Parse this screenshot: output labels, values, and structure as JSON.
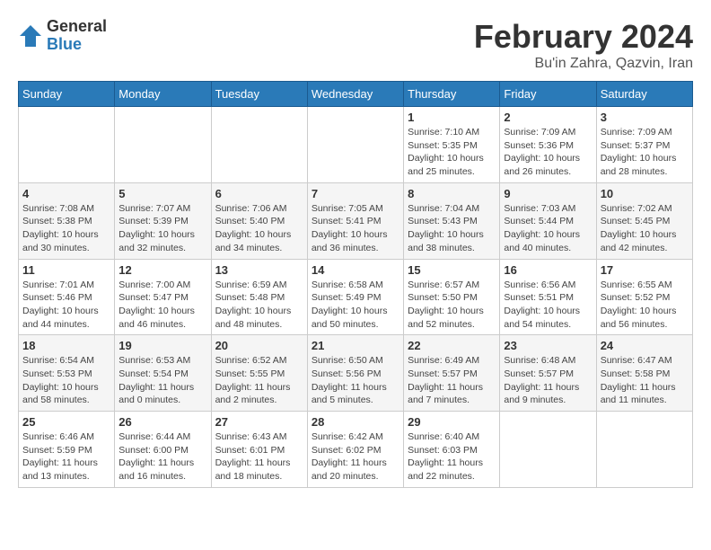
{
  "logo": {
    "general": "General",
    "blue": "Blue"
  },
  "title": "February 2024",
  "subtitle": "Bu'in Zahra, Qazvin, Iran",
  "days_header": [
    "Sunday",
    "Monday",
    "Tuesday",
    "Wednesday",
    "Thursday",
    "Friday",
    "Saturday"
  ],
  "weeks": [
    [
      {
        "day": "",
        "info": ""
      },
      {
        "day": "",
        "info": ""
      },
      {
        "day": "",
        "info": ""
      },
      {
        "day": "",
        "info": ""
      },
      {
        "day": "1",
        "info": "Sunrise: 7:10 AM\nSunset: 5:35 PM\nDaylight: 10 hours\nand 25 minutes."
      },
      {
        "day": "2",
        "info": "Sunrise: 7:09 AM\nSunset: 5:36 PM\nDaylight: 10 hours\nand 26 minutes."
      },
      {
        "day": "3",
        "info": "Sunrise: 7:09 AM\nSunset: 5:37 PM\nDaylight: 10 hours\nand 28 minutes."
      }
    ],
    [
      {
        "day": "4",
        "info": "Sunrise: 7:08 AM\nSunset: 5:38 PM\nDaylight: 10 hours\nand 30 minutes."
      },
      {
        "day": "5",
        "info": "Sunrise: 7:07 AM\nSunset: 5:39 PM\nDaylight: 10 hours\nand 32 minutes."
      },
      {
        "day": "6",
        "info": "Sunrise: 7:06 AM\nSunset: 5:40 PM\nDaylight: 10 hours\nand 34 minutes."
      },
      {
        "day": "7",
        "info": "Sunrise: 7:05 AM\nSunset: 5:41 PM\nDaylight: 10 hours\nand 36 minutes."
      },
      {
        "day": "8",
        "info": "Sunrise: 7:04 AM\nSunset: 5:43 PM\nDaylight: 10 hours\nand 38 minutes."
      },
      {
        "day": "9",
        "info": "Sunrise: 7:03 AM\nSunset: 5:44 PM\nDaylight: 10 hours\nand 40 minutes."
      },
      {
        "day": "10",
        "info": "Sunrise: 7:02 AM\nSunset: 5:45 PM\nDaylight: 10 hours\nand 42 minutes."
      }
    ],
    [
      {
        "day": "11",
        "info": "Sunrise: 7:01 AM\nSunset: 5:46 PM\nDaylight: 10 hours\nand 44 minutes."
      },
      {
        "day": "12",
        "info": "Sunrise: 7:00 AM\nSunset: 5:47 PM\nDaylight: 10 hours\nand 46 minutes."
      },
      {
        "day": "13",
        "info": "Sunrise: 6:59 AM\nSunset: 5:48 PM\nDaylight: 10 hours\nand 48 minutes."
      },
      {
        "day": "14",
        "info": "Sunrise: 6:58 AM\nSunset: 5:49 PM\nDaylight: 10 hours\nand 50 minutes."
      },
      {
        "day": "15",
        "info": "Sunrise: 6:57 AM\nSunset: 5:50 PM\nDaylight: 10 hours\nand 52 minutes."
      },
      {
        "day": "16",
        "info": "Sunrise: 6:56 AM\nSunset: 5:51 PM\nDaylight: 10 hours\nand 54 minutes."
      },
      {
        "day": "17",
        "info": "Sunrise: 6:55 AM\nSunset: 5:52 PM\nDaylight: 10 hours\nand 56 minutes."
      }
    ],
    [
      {
        "day": "18",
        "info": "Sunrise: 6:54 AM\nSunset: 5:53 PM\nDaylight: 10 hours\nand 58 minutes."
      },
      {
        "day": "19",
        "info": "Sunrise: 6:53 AM\nSunset: 5:54 PM\nDaylight: 11 hours\nand 0 minutes."
      },
      {
        "day": "20",
        "info": "Sunrise: 6:52 AM\nSunset: 5:55 PM\nDaylight: 11 hours\nand 2 minutes."
      },
      {
        "day": "21",
        "info": "Sunrise: 6:50 AM\nSunset: 5:56 PM\nDaylight: 11 hours\nand 5 minutes."
      },
      {
        "day": "22",
        "info": "Sunrise: 6:49 AM\nSunset: 5:57 PM\nDaylight: 11 hours\nand 7 minutes."
      },
      {
        "day": "23",
        "info": "Sunrise: 6:48 AM\nSunset: 5:57 PM\nDaylight: 11 hours\nand 9 minutes."
      },
      {
        "day": "24",
        "info": "Sunrise: 6:47 AM\nSunset: 5:58 PM\nDaylight: 11 hours\nand 11 minutes."
      }
    ],
    [
      {
        "day": "25",
        "info": "Sunrise: 6:46 AM\nSunset: 5:59 PM\nDaylight: 11 hours\nand 13 minutes."
      },
      {
        "day": "26",
        "info": "Sunrise: 6:44 AM\nSunset: 6:00 PM\nDaylight: 11 hours\nand 16 minutes."
      },
      {
        "day": "27",
        "info": "Sunrise: 6:43 AM\nSunset: 6:01 PM\nDaylight: 11 hours\nand 18 minutes."
      },
      {
        "day": "28",
        "info": "Sunrise: 6:42 AM\nSunset: 6:02 PM\nDaylight: 11 hours\nand 20 minutes."
      },
      {
        "day": "29",
        "info": "Sunrise: 6:40 AM\nSunset: 6:03 PM\nDaylight: 11 hours\nand 22 minutes."
      },
      {
        "day": "",
        "info": ""
      },
      {
        "day": "",
        "info": ""
      }
    ]
  ]
}
